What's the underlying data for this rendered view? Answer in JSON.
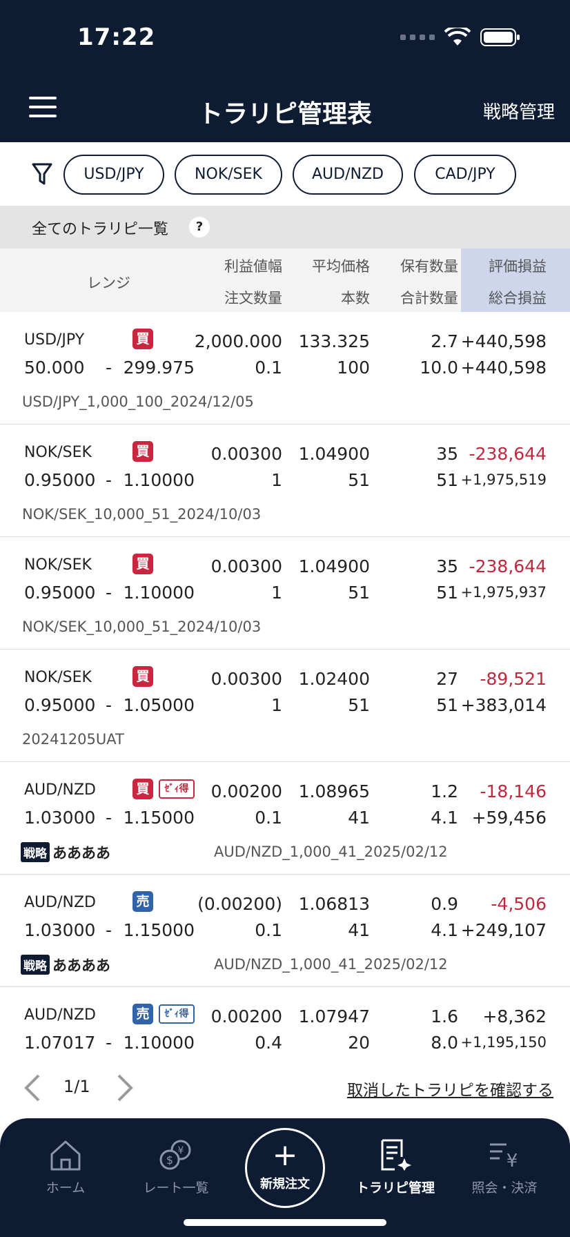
{
  "status_bar": {
    "time": "17:22"
  },
  "header": {
    "title": "トラリピ管理表",
    "strategy_link": "戦略管理"
  },
  "filters": [
    "USD/JPY",
    "NOK/SEK",
    "AUD/NZD",
    "CAD/JPY"
  ],
  "section": {
    "title": "全てのトラリピ一覧",
    "help": "?"
  },
  "columns": {
    "range": "レンジ",
    "profit_width": "利益値幅",
    "order_qty": "注文数量",
    "avg_price": "平均価格",
    "count": "本数",
    "holding_qty": "保有数量",
    "total_qty": "合計数量",
    "valuation_pl": "評価損益",
    "total_pl": "総合損益"
  },
  "rows": [
    {
      "pair": "USD/JPY",
      "side": "買",
      "tag": "",
      "profit_width": "2,000.000",
      "avg_price": "133.325",
      "holding_qty": "2.7",
      "valuation_pl": "+440,598",
      "range_low": "50.000",
      "sep": "-",
      "range_high": "299.975",
      "order_qty": "0.1",
      "count": "100",
      "total_qty": "10.0",
      "total_pl": "+440,598",
      "strategy": "",
      "strategy_name": "",
      "memo": "USD/JPY_1,000_100_2024/12/05"
    },
    {
      "pair": "NOK/SEK",
      "side": "買",
      "tag": "",
      "profit_width": "0.00300",
      "avg_price": "1.04900",
      "holding_qty": "35",
      "valuation_pl": "-238,644",
      "range_low": "0.95000",
      "sep": "-",
      "range_high": "1.10000",
      "order_qty": "1",
      "count": "51",
      "total_qty": "51",
      "total_pl": "+1,975,519",
      "strategy": "",
      "strategy_name": "",
      "memo": "NOK/SEK_10,000_51_2024/10/03"
    },
    {
      "pair": "NOK/SEK",
      "side": "買",
      "tag": "",
      "profit_width": "0.00300",
      "avg_price": "1.04900",
      "holding_qty": "35",
      "valuation_pl": "-238,644",
      "range_low": "0.95000",
      "sep": "-",
      "range_high": "1.10000",
      "order_qty": "1",
      "count": "51",
      "total_qty": "51",
      "total_pl": "+1,975,937",
      "strategy": "",
      "strategy_name": "",
      "memo": "NOK/SEK_10,000_51_2024/10/03"
    },
    {
      "pair": "NOK/SEK",
      "side": "買",
      "tag": "",
      "profit_width": "0.00300",
      "avg_price": "1.02400",
      "holding_qty": "27",
      "valuation_pl": "-89,521",
      "range_low": "0.95000",
      "sep": "-",
      "range_high": "1.05000",
      "order_qty": "1",
      "count": "51",
      "total_qty": "51",
      "total_pl": "+383,014",
      "strategy": "",
      "strategy_name": "",
      "memo": "20241205UAT"
    },
    {
      "pair": "AUD/NZD",
      "side": "買",
      "tag": "ｾﾞｨ得",
      "profit_width": "0.00200",
      "avg_price": "1.08965",
      "holding_qty": "1.2",
      "valuation_pl": "-18,146",
      "range_low": "1.03000",
      "sep": "-",
      "range_high": "1.15000",
      "order_qty": "0.1",
      "count": "41",
      "total_qty": "4.1",
      "total_pl": "+59,456",
      "strategy": "戦略",
      "strategy_name": "ああああ",
      "memo": "AUD/NZD_1,000_41_2025/02/12"
    },
    {
      "pair": "AUD/NZD",
      "side": "売",
      "tag": "",
      "profit_width": "(0.00200)",
      "avg_price": "1.06813",
      "holding_qty": "0.9",
      "valuation_pl": "-4,506",
      "range_low": "1.03000",
      "sep": "-",
      "range_high": "1.15000",
      "order_qty": "0.1",
      "count": "41",
      "total_qty": "4.1",
      "total_pl": "+249,107",
      "strategy": "戦略",
      "strategy_name": "ああああ",
      "memo": "AUD/NZD_1,000_41_2025/02/12"
    },
    {
      "pair": "AUD/NZD",
      "side": "売",
      "tag": "ｾﾞｨ得",
      "profit_width": "0.00200",
      "avg_price": "1.07947",
      "holding_qty": "1.6",
      "valuation_pl": "+8,362",
      "range_low": "1.07017",
      "sep": "-",
      "range_high": "1.10000",
      "order_qty": "0.4",
      "count": "20",
      "total_qty": "8.0",
      "total_pl": "+1,195,150",
      "strategy": "",
      "strategy_name": "",
      "memo": ""
    }
  ],
  "pager": {
    "page": "1/1",
    "cancel_link": "取消したトラリピを確認する"
  },
  "tabbar": {
    "home": "ホーム",
    "rates": "レート一覧",
    "new_order_plus": "+",
    "new_order": "新規注文",
    "trarepeat": "トラリピ管理",
    "inquiry": "照会・決済"
  },
  "colors": {
    "navy": "#0d1b33",
    "buy": "#c8283f",
    "sell": "#3263a8",
    "negative": "#c0283e",
    "highlight": "#cfd6ec"
  }
}
